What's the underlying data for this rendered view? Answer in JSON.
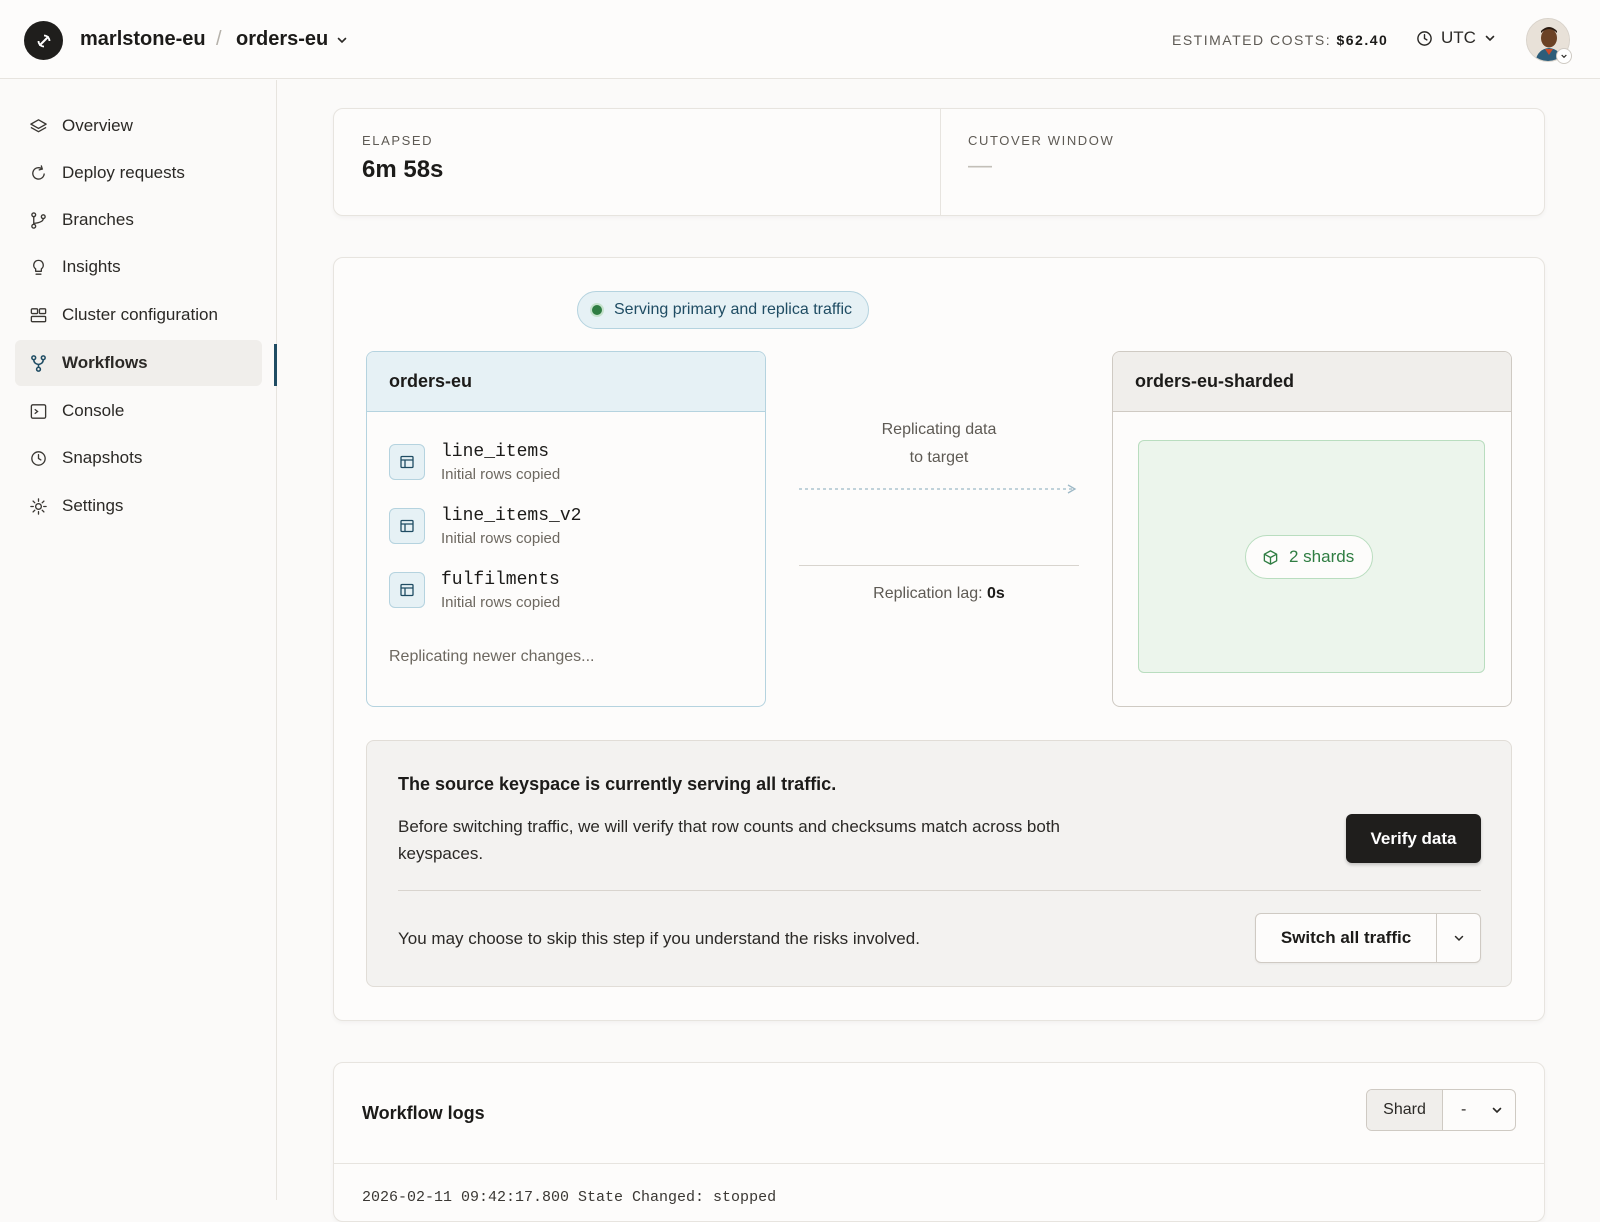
{
  "header": {
    "org": "marlstone-eu",
    "separator": "/",
    "database": "orders-eu",
    "costs_label": "ESTIMATED COSTS:",
    "costs_value": "$62.40",
    "timezone": "UTC"
  },
  "sidebar": {
    "items": [
      {
        "label": "Overview",
        "icon": "layers-icon"
      },
      {
        "label": "Deploy requests",
        "icon": "refresh-icon"
      },
      {
        "label": "Branches",
        "icon": "branch-icon"
      },
      {
        "label": "Insights",
        "icon": "lightbulb-icon"
      },
      {
        "label": "Cluster configuration",
        "icon": "grid-icon"
      },
      {
        "label": "Workflows",
        "icon": "workflow-icon",
        "active": true
      },
      {
        "label": "Console",
        "icon": "terminal-icon"
      },
      {
        "label": "Snapshots",
        "icon": "clock-icon"
      },
      {
        "label": "Settings",
        "icon": "gear-icon"
      }
    ]
  },
  "metrics": {
    "elapsed_label": "ELAPSED",
    "elapsed_value": "6m 58s",
    "cutover_label": "CUTOVER WINDOW",
    "cutover_value": "—"
  },
  "workflow": {
    "status": "Serving primary and replica traffic",
    "source": {
      "name": "orders-eu",
      "tables": [
        {
          "name": "line_items",
          "status": "Initial rows copied"
        },
        {
          "name": "line_items_v2",
          "status": "Initial rows copied"
        },
        {
          "name": "fulfilments",
          "status": "Initial rows copied"
        }
      ],
      "footer": "Replicating newer changes..."
    },
    "middle": {
      "line1": "Replicating data",
      "line2": "to target",
      "lag_label": "Replication lag:",
      "lag_value": "0s"
    },
    "target": {
      "name": "orders-eu-sharded",
      "shards": "2 shards"
    }
  },
  "notice": {
    "title": "The source keyspace is currently serving all traffic.",
    "body": "Before switching traffic, we will verify that row counts and checksums match across both keyspaces.",
    "verify_button": "Verify data",
    "skip_text": "You may choose to skip this step if you understand the risks involved.",
    "switch_button": "Switch all traffic"
  },
  "logs": {
    "title": "Workflow logs",
    "shard_label": "Shard",
    "shard_value": "-",
    "first_line": "2026-02-11 09:42:17.800  State Changed: stopped"
  },
  "colors": {
    "accent": "#1f4c63",
    "success": "#2f7d42",
    "dark_button": "#1f1e1c"
  }
}
